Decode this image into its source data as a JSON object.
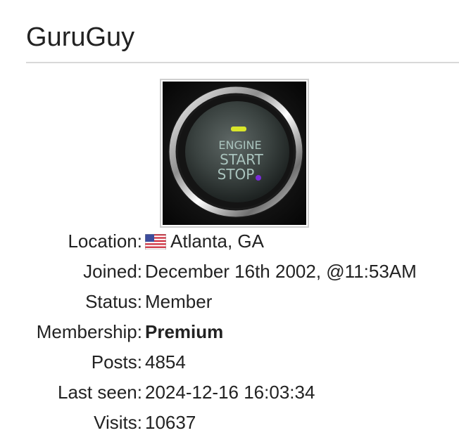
{
  "profile": {
    "username": "GuruGuy",
    "avatar": {
      "button_text_line1": "ENGINE",
      "button_text_line2": "START",
      "button_text_line3": "STOP",
      "indicator_color": "#d9e62a",
      "dot_color": "#7a2bd9"
    },
    "fields": [
      {
        "label": "Location:",
        "value": "Atlanta, GA",
        "flag_icon": "us-flag-icon"
      },
      {
        "label": "Joined:",
        "value": "December 16th 2002, @11:53AM"
      },
      {
        "label": "Status:",
        "value": "Member"
      },
      {
        "label": "Membership:",
        "value": "Premium"
      },
      {
        "label": "Posts:",
        "value": "4854"
      },
      {
        "label": "Last seen:",
        "value": "2024-12-16 16:03:34"
      },
      {
        "label": "Visits:",
        "value": "10637"
      }
    ]
  }
}
